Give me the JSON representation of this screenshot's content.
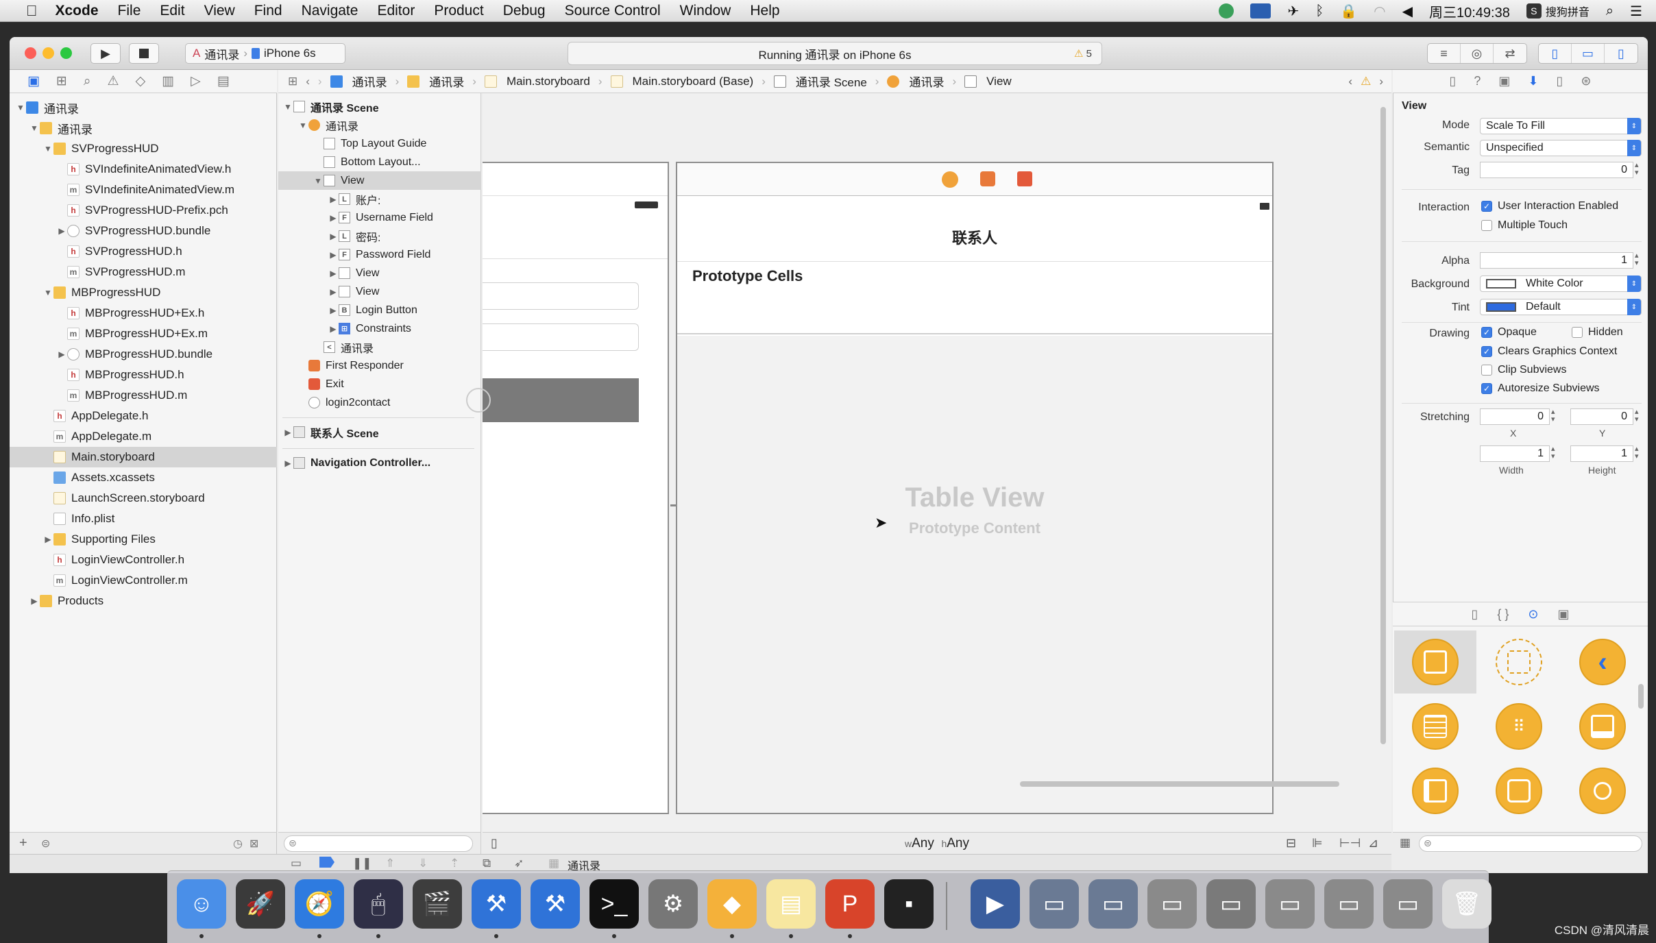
{
  "menubar": {
    "app": "Xcode",
    "items": [
      "File",
      "Edit",
      "View",
      "Find",
      "Navigate",
      "Editor",
      "Product",
      "Debug",
      "Source Control",
      "Window",
      "Help"
    ],
    "clock": "周三10:49:38",
    "ime": "搜狗拼音"
  },
  "toolbar": {
    "scheme": "通讯录",
    "device": "iPhone 6s",
    "status": "Running 通讯录 on iPhone 6s",
    "warnings": "5"
  },
  "navigator": {
    "rows": [
      {
        "label": "通讯录",
        "depth": 0,
        "icon": "proj",
        "open": true
      },
      {
        "label": "通讯录",
        "depth": 1,
        "icon": "folder",
        "open": true
      },
      {
        "label": "SVProgressHUD",
        "depth": 2,
        "icon": "folder",
        "open": true
      },
      {
        "label": "SVIndefiniteAnimatedView.h",
        "depth": 3,
        "icon": "h"
      },
      {
        "label": "SVIndefiniteAnimatedView.m",
        "depth": 3,
        "icon": "m"
      },
      {
        "label": "SVProgressHUD-Prefix.pch",
        "depth": 3,
        "icon": "h"
      },
      {
        "label": "SVProgressHUD.bundle",
        "depth": 3,
        "icon": "bundle",
        "open": false
      },
      {
        "label": "SVProgressHUD.h",
        "depth": 3,
        "icon": "h"
      },
      {
        "label": "SVProgressHUD.m",
        "depth": 3,
        "icon": "m"
      },
      {
        "label": "MBProgressHUD",
        "depth": 2,
        "icon": "folder",
        "open": true
      },
      {
        "label": "MBProgressHUD+Ex.h",
        "depth": 3,
        "icon": "h"
      },
      {
        "label": "MBProgressHUD+Ex.m",
        "depth": 3,
        "icon": "m"
      },
      {
        "label": "MBProgressHUD.bundle",
        "depth": 3,
        "icon": "bundle",
        "open": false
      },
      {
        "label": "MBProgressHUD.h",
        "depth": 3,
        "icon": "h"
      },
      {
        "label": "MBProgressHUD.m",
        "depth": 3,
        "icon": "m"
      },
      {
        "label": "AppDelegate.h",
        "depth": 2,
        "icon": "h"
      },
      {
        "label": "AppDelegate.m",
        "depth": 2,
        "icon": "m"
      },
      {
        "label": "Main.storyboard",
        "depth": 2,
        "icon": "sb",
        "selected": true
      },
      {
        "label": "Assets.xcassets",
        "depth": 2,
        "icon": "assets"
      },
      {
        "label": "LaunchScreen.storyboard",
        "depth": 2,
        "icon": "sb"
      },
      {
        "label": "Info.plist",
        "depth": 2,
        "icon": "plist"
      },
      {
        "label": "Supporting Files",
        "depth": 2,
        "icon": "folder",
        "open": false
      },
      {
        "label": "LoginViewController.h",
        "depth": 2,
        "icon": "h"
      },
      {
        "label": "LoginViewController.m",
        "depth": 2,
        "icon": "m"
      },
      {
        "label": "Products",
        "depth": 1,
        "icon": "folder",
        "open": false
      }
    ]
  },
  "jumpbar": {
    "crumbs": [
      "通讯录",
      "通讯录",
      "Main.storyboard",
      "Main.storyboard (Base)",
      "通讯录 Scene",
      "通讯录",
      "View"
    ]
  },
  "outline": {
    "rows": [
      {
        "label": "通讯录 Scene",
        "depth": 0,
        "icon": "scene",
        "open": true,
        "bold": true
      },
      {
        "label": "通讯录",
        "depth": 1,
        "icon": "orange",
        "open": true
      },
      {
        "label": "Top Layout Guide",
        "depth": 2,
        "icon": "box"
      },
      {
        "label": "Bottom Layout...",
        "depth": 2,
        "icon": "box"
      },
      {
        "label": "View",
        "depth": 2,
        "icon": "box",
        "open": true,
        "selected": true
      },
      {
        "label": "账户:",
        "depth": 3,
        "icon": "L",
        "open": false
      },
      {
        "label": "Username Field",
        "depth": 3,
        "icon": "F",
        "open": false
      },
      {
        "label": "密码:",
        "depth": 3,
        "icon": "L",
        "open": false
      },
      {
        "label": "Password Field",
        "depth": 3,
        "icon": "F",
        "open": false
      },
      {
        "label": "View",
        "depth": 3,
        "icon": "box",
        "open": false
      },
      {
        "label": "View",
        "depth": 3,
        "icon": "box",
        "open": false
      },
      {
        "label": "Login Button",
        "depth": 3,
        "icon": "B",
        "open": false
      },
      {
        "label": "Constraints",
        "depth": 3,
        "icon": "blue",
        "open": false
      },
      {
        "label": "通讯录",
        "depth": 2,
        "icon": "<"
      },
      {
        "label": "First Responder",
        "depth": 1,
        "icon": "orange"
      },
      {
        "label": "Exit",
        "depth": 1,
        "icon": "red"
      },
      {
        "label": "login2contact",
        "depth": 1,
        "icon": "segue"
      }
    ],
    "scenes": [
      "联系人 Scene",
      "Navigation Controller..."
    ]
  },
  "canvas": {
    "nav_title": "联系人",
    "section": "Prototype Cells",
    "table_title": "Table View",
    "table_sub": "Prototype Content",
    "size_class_w": "Any",
    "size_class_h": "Any",
    "size_w_prefix": "w",
    "size_h_prefix": "h",
    "bottom_crumb": "通讯录"
  },
  "inspector": {
    "title": "View",
    "mode_label": "Mode",
    "mode": "Scale To Fill",
    "semantic_label": "Semantic",
    "semantic": "Unspecified",
    "tag_label": "Tag",
    "tag": "0",
    "interaction_label": "Interaction",
    "uie": "User Interaction Enabled",
    "mt": "Multiple Touch",
    "alpha_label": "Alpha",
    "alpha": "1",
    "bg_label": "Background",
    "bg": "White Color",
    "tint_label": "Tint",
    "tint": "Default",
    "drawing_label": "Drawing",
    "opaque": "Opaque",
    "hidden": "Hidden",
    "clears": "Clears Graphics Context",
    "clip": "Clip Subviews",
    "autoresize": "Autoresize Subviews",
    "stretch_label": "Stretching",
    "sx": "0",
    "sy": "0",
    "sw": "1",
    "sh": "1",
    "x": "X",
    "y": "Y",
    "width": "Width",
    "height": "Height",
    "tint_color": "#2e6be0"
  },
  "dock": {
    "apps": [
      "finder-icon",
      "launchpad-icon",
      "safari-icon",
      "mouse-icon",
      "photobooth-icon",
      "xcode-icon",
      "instruments-icon",
      "terminal-icon",
      "system-preferences-icon",
      "sketch-icon",
      "notes-icon",
      "powerpoint-icon",
      "console-icon",
      "screen-recorder-icon",
      "window-1-icon",
      "window-2-icon",
      "window-3-icon",
      "window-4-icon",
      "window-5-icon",
      "window-6-icon",
      "window-7-icon",
      "trash-icon"
    ]
  },
  "watermark": "CSDN @清风清晨"
}
